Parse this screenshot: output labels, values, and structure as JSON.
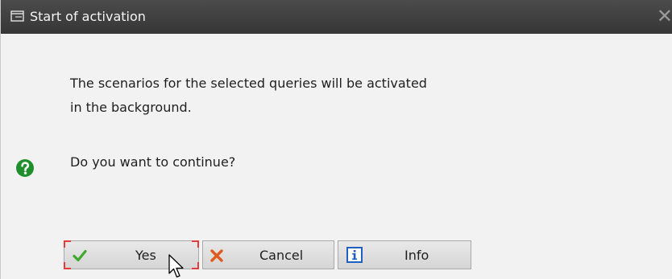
{
  "window": {
    "title": "Start of activation",
    "close_glyph": "✕",
    "title_icon": "window-icon"
  },
  "message": {
    "line1": "The scenarios for the selected queries will be activated",
    "line2": "in the background.",
    "question": "Do you want to continue?",
    "icon": "question-icon",
    "icon_color": "#1f8f2c"
  },
  "buttons": {
    "yes": {
      "label": "Yes",
      "icon": "checkmark-icon",
      "icon_color": "#3faa2b",
      "focused": true
    },
    "cancel": {
      "label": "Cancel",
      "icon": "x-icon",
      "icon_color": "#e05a1e"
    },
    "info": {
      "label": "Info",
      "icon": "info-icon",
      "icon_color": "#1f5fbf"
    }
  },
  "colors": {
    "titlebar": "#3f3f3f",
    "background": "#f2f2f2",
    "focus_marker": "#e53b3b"
  }
}
